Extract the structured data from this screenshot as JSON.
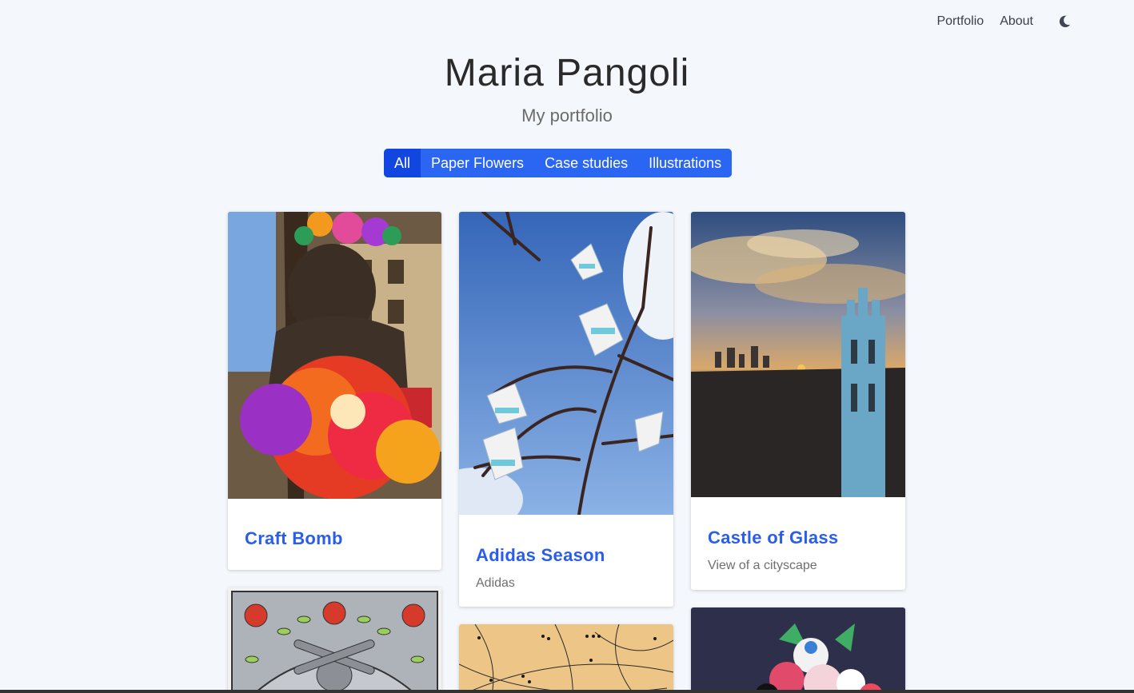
{
  "nav": {
    "portfolio": "Portfolio",
    "about": "About",
    "theme_icon": "moon-icon"
  },
  "header": {
    "title": "Maria Pangoli",
    "subtitle": "My portfolio"
  },
  "filters": [
    "All",
    "Paper Flowers",
    "Case studies",
    "Illustrations"
  ],
  "active_filter": "All",
  "cards": [
    {
      "title": "Craft Bomb",
      "subtitle": ""
    },
    {
      "title": "Adidas Season",
      "subtitle": "Adidas"
    },
    {
      "title": "Castle of Glass",
      "subtitle": "View of a cityscape"
    }
  ],
  "colors": {
    "accent": "#2a66f2",
    "active": "#1146e0",
    "title_link": "#2a5ee8"
  }
}
